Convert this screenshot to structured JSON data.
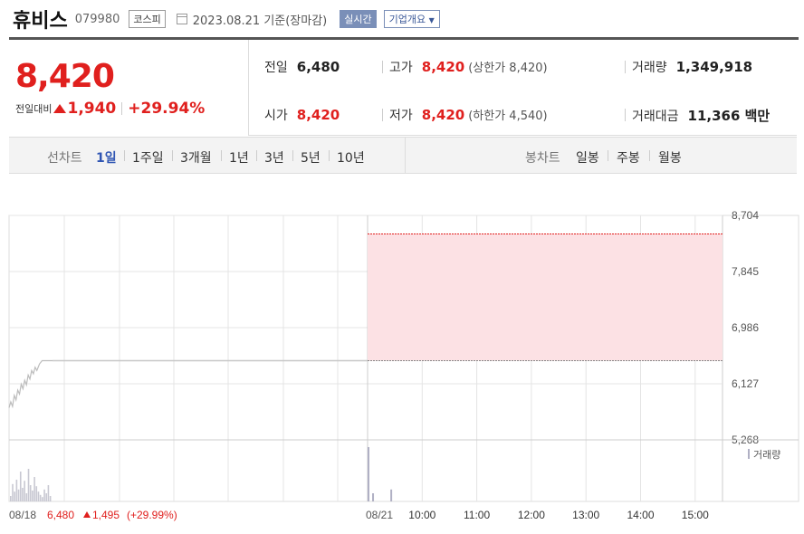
{
  "header": {
    "name": "휴비스",
    "code": "079980",
    "market": "코스피",
    "date": "2023.08.21 기준(장마감)",
    "realtime_label": "실시간",
    "overview_label": "기업개요"
  },
  "price": {
    "current": "8,420",
    "diff_label": "전일대비",
    "diff": "1,940",
    "rate": "+29.94%"
  },
  "stats": {
    "prev": {
      "label": "전일",
      "value": "6,480"
    },
    "high": {
      "label": "고가",
      "value": "8,420",
      "sub": "(상한가 8,420)"
    },
    "volume": {
      "label": "거래량",
      "value": "1,349,918"
    },
    "open": {
      "label": "시가",
      "value": "8,420"
    },
    "low": {
      "label": "저가",
      "value": "8,420",
      "sub": "(하한가 4,540)"
    },
    "amount": {
      "label": "거래대금",
      "value": "11,366 백만"
    }
  },
  "tabs": {
    "line_label": "선차트",
    "line_items": [
      "1일",
      "1주일",
      "3개월",
      "1년",
      "3년",
      "5년",
      "10년"
    ],
    "active_index": 0,
    "candle_label": "봉차트",
    "candle_items": [
      "일봉",
      "주봉",
      "월봉"
    ]
  },
  "colors": {
    "up": "#e0201e",
    "price_line": "#c8c8c8",
    "fill": "#fce1e4",
    "grid": "#e4e4e4",
    "volume_bar": "#b0b0c4",
    "accent": "#2f55b3"
  },
  "chart_data": {
    "type": "line",
    "y_ticks": [
      "8,704",
      "7,845",
      "6,986",
      "6,127",
      "5,268"
    ],
    "y_tick_values": [
      8704,
      7845,
      6986,
      6127,
      5268
    ],
    "ylim": [
      5268,
      8704
    ],
    "grid": true,
    "prev_day_series": [
      {
        "t": 0.0,
        "v": 5760
      },
      {
        "t": 0.04,
        "v": 5850
      },
      {
        "t": 0.08,
        "v": 5780
      },
      {
        "t": 0.12,
        "v": 5950
      },
      {
        "t": 0.16,
        "v": 5880
      },
      {
        "t": 0.2,
        "v": 6030
      },
      {
        "t": 0.24,
        "v": 5970
      },
      {
        "t": 0.28,
        "v": 6120
      },
      {
        "t": 0.32,
        "v": 6050
      },
      {
        "t": 0.36,
        "v": 6180
      },
      {
        "t": 0.4,
        "v": 6110
      },
      {
        "t": 0.44,
        "v": 6260
      },
      {
        "t": 0.48,
        "v": 6200
      },
      {
        "t": 0.52,
        "v": 6330
      },
      {
        "t": 0.56,
        "v": 6280
      },
      {
        "t": 0.6,
        "v": 6380
      },
      {
        "t": 0.64,
        "v": 6330
      },
      {
        "t": 0.7,
        "v": 6430
      },
      {
        "t": 0.76,
        "v": 6480
      },
      {
        "t": 1.0,
        "v": 6480
      }
    ],
    "prev_close": 6480,
    "today_price": 8420,
    "today_start": "09:00",
    "session_end": "15:30",
    "x_labels": [
      "08/18",
      "08/21",
      "10:00",
      "11:00",
      "12:00",
      "13:00",
      "14:00",
      "15:00"
    ],
    "prev_day_summary": {
      "close": "6,480",
      "change": "1,495",
      "rate": "(+29.99%)"
    },
    "volume_label": "거래량",
    "volume_prev_day": [
      0.1,
      0.32,
      0.18,
      0.4,
      0.22,
      0.55,
      0.25,
      0.38,
      0.15,
      0.6,
      0.3,
      0.2,
      0.45,
      0.28,
      0.18,
      0.12,
      0.08,
      0.22,
      0.15,
      0.3,
      0.1
    ],
    "volume_today": [
      {
        "time": "09:00",
        "level": 1.0
      },
      {
        "time": "09:05",
        "level": 0.15
      },
      {
        "time": "09:25",
        "level": 0.22
      }
    ]
  }
}
